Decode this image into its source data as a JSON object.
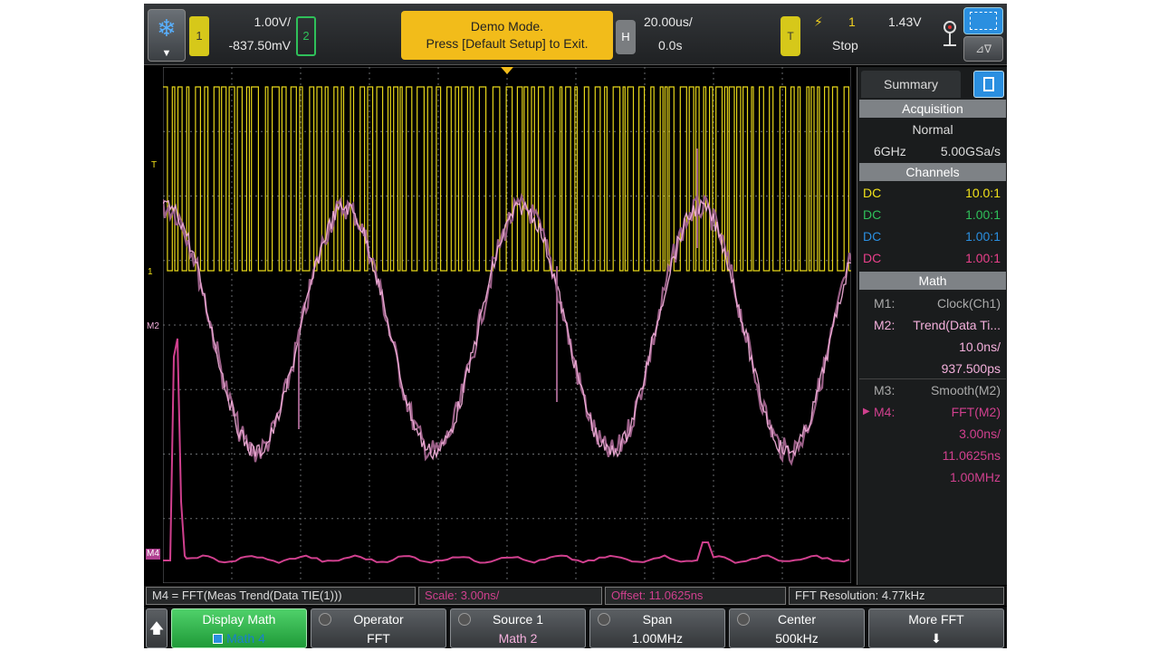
{
  "colors": {
    "ch1": "#f2e21a",
    "ch2": "#2fc05a",
    "ch3": "#2a8fe0",
    "ch4": "#e8408a",
    "math2": "#f4b0dc",
    "math2_dark": "#9a5f87",
    "math4": "#d0408e",
    "accent_blue": "#2a8fe0",
    "banner": "#f2bc1a",
    "grid": "#6a6d70"
  },
  "topbar": {
    "menu_icon": "snowflake-icon",
    "ch1": {
      "number": "1",
      "scale": "1.00V/",
      "offset": "-837.50mV"
    },
    "ch2": {
      "number": "2"
    },
    "banner": {
      "line1": "Demo Mode.",
      "line2": "Press [Default Setup] to Exit."
    },
    "horizontal": {
      "tag": "H",
      "time_per_div": "20.00us/",
      "delay": "0.0s"
    },
    "trigger": {
      "tag": "T",
      "edge_icon": "rising-edge-icon",
      "source": "1",
      "level": "1.43V",
      "state": "Stop"
    },
    "probe_icon": "probe-icon",
    "zoom_icon": "zoom-icon",
    "delta_icon": "delta-icon"
  },
  "graticule": {
    "markers": {
      "trigger_level": "T",
      "ch1_ground": "1",
      "math2_ref": "M2",
      "math4_ref": "M4"
    }
  },
  "side_panel": {
    "tab": "Summary",
    "tab_icon": "document-icon",
    "acquisition": {
      "header": "Acquisition",
      "mode": "Normal",
      "bandwidth": "6GHz",
      "sample_rate": "5.00GSa/s"
    },
    "channels": {
      "header": "Channels",
      "rows": [
        {
          "coupling": "DC",
          "probe": "10.0:1",
          "color": "#f2e21a"
        },
        {
          "coupling": "DC",
          "probe": "1.00:1",
          "color": "#2fc05a"
        },
        {
          "coupling": "DC",
          "probe": "1.00:1",
          "color": "#2a8fe0"
        },
        {
          "coupling": "DC",
          "probe": "1.00:1",
          "color": "#e8408a"
        }
      ]
    },
    "math": {
      "header": "Math",
      "m1": {
        "label": "M1:",
        "value": "Clock(Ch1)"
      },
      "m2": {
        "label": "M2:",
        "value": "Trend(Data Ti...",
        "scale": "10.0ns/",
        "offset": "937.500ps"
      },
      "m3": {
        "label": "M3:",
        "value": "Smooth(M2)"
      },
      "m4": {
        "label": "M4:",
        "value": "FFT(M2)",
        "scale": "3.00ns/",
        "offset": "11.0625ns",
        "span": "1.00MHz"
      }
    }
  },
  "status_bar": {
    "expression": "M4 = FFT(Meas Trend(Data TIE(1)))",
    "scale": "Scale: 3.00ns/",
    "offset": "Offset: 11.0625ns",
    "fft_resolution": "FFT Resolution: 4.77kHz"
  },
  "softkeys": {
    "back": "🡅",
    "display_math": {
      "title": "Display Math",
      "value": "Math 4"
    },
    "operator": {
      "title": "Operator",
      "value": "FFT"
    },
    "source1": {
      "title": "Source 1",
      "value": "Math 2"
    },
    "span": {
      "title": "Span",
      "value": "1.00MHz"
    },
    "center": {
      "title": "Center",
      "value": "500kHz"
    },
    "more_fft": {
      "title": "More FFT",
      "arrow_icon": "down-arrow-icon"
    }
  }
}
